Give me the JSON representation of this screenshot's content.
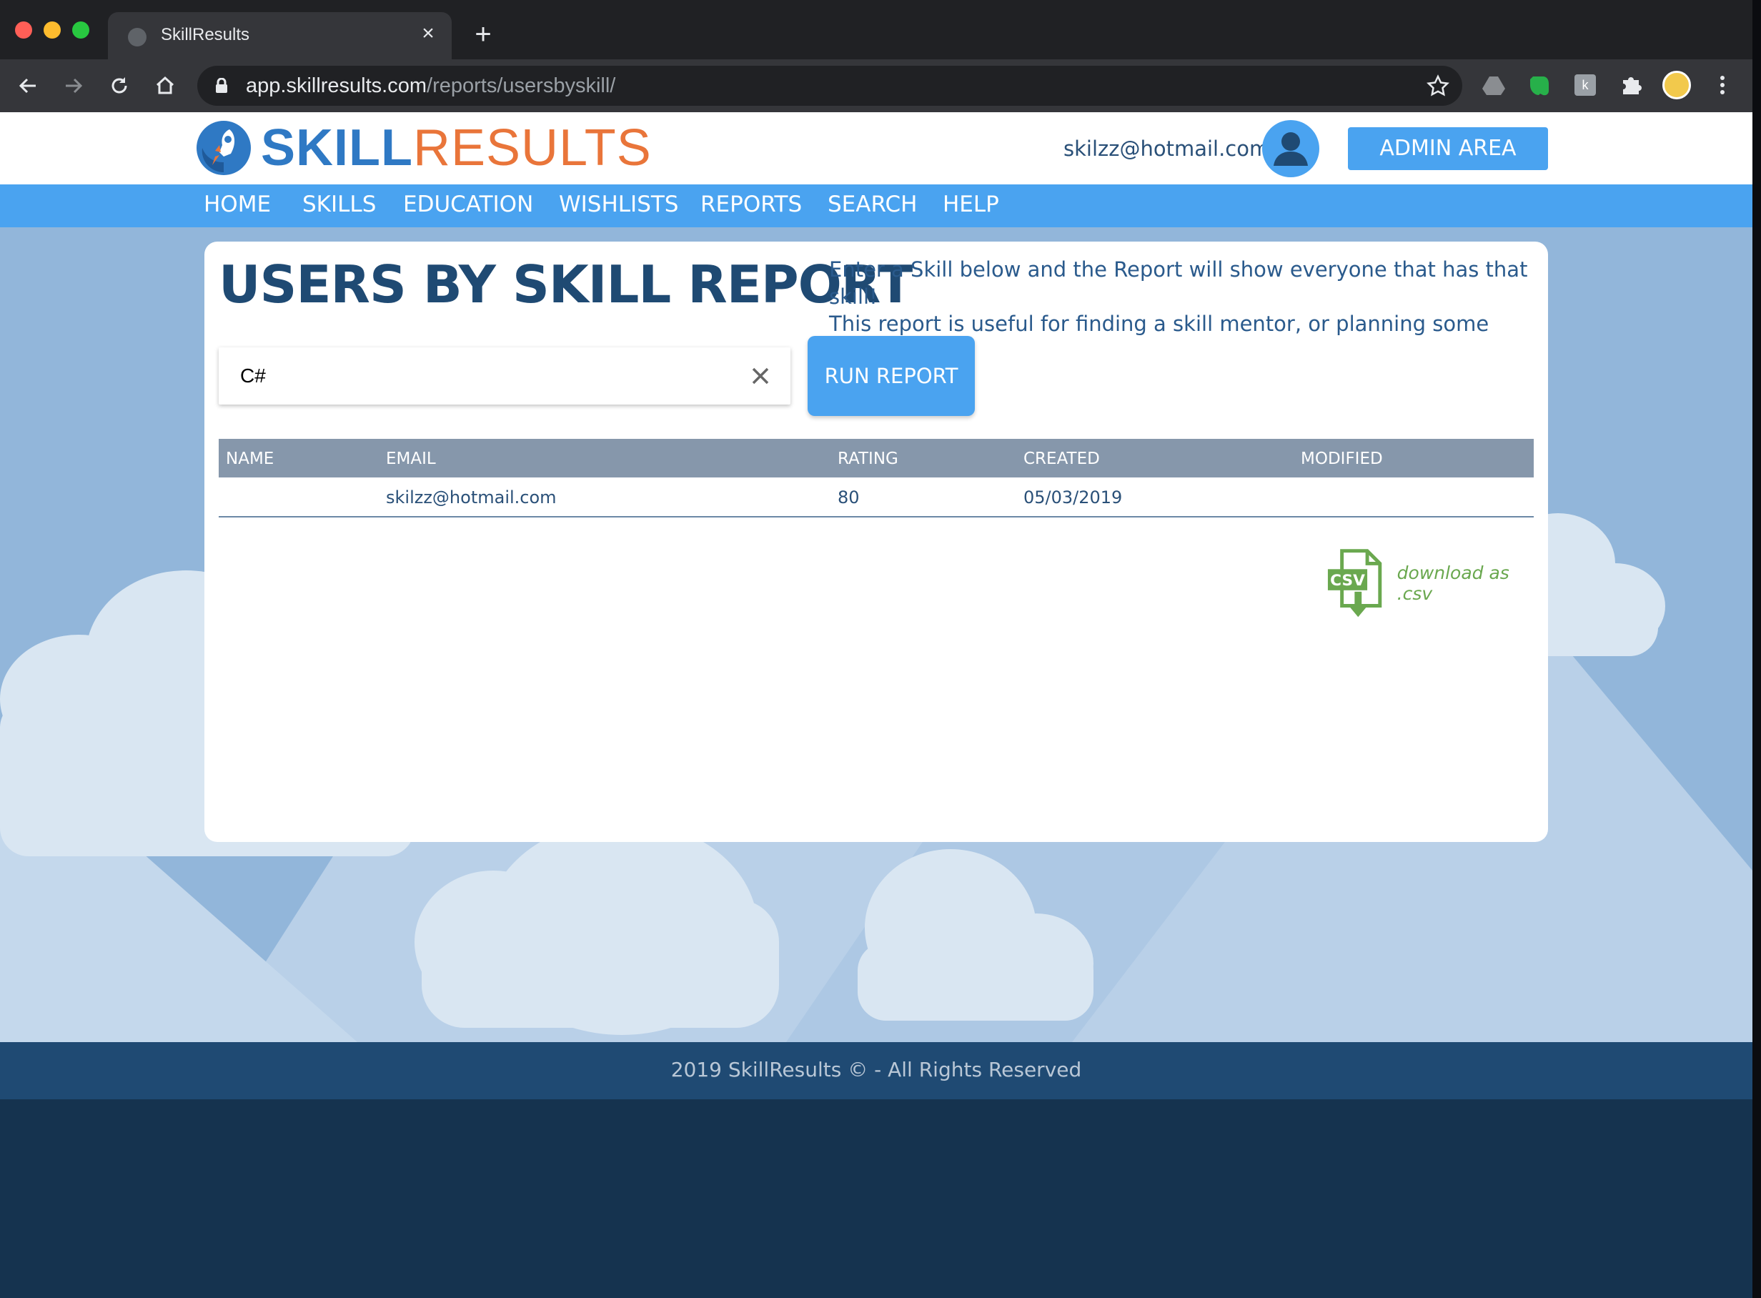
{
  "browser": {
    "tab_title": "SkillResults",
    "url_host": "app.skillresults.com",
    "url_path": "/reports/usersbyskill/"
  },
  "header": {
    "logo_skill": "SKILL",
    "logo_results": "RESULTS",
    "user_email": "skilzz@hotmail.com",
    "admin_button": "ADMIN AREA"
  },
  "nav": {
    "items": [
      "HOME",
      "SKILLS",
      "EDUCATION",
      "WISHLISTS",
      "REPORTS",
      "SEARCH",
      "HELP"
    ]
  },
  "page": {
    "title": "USERS BY SKILL REPORT",
    "description_line1": "Enter a Skill below and the Report will show everyone that has that skill!",
    "description_line2": "This report is useful for finding a skill mentor, or planning some work",
    "search_value": "C#",
    "run_button": "RUN REPORT"
  },
  "table": {
    "columns": [
      "NAME",
      "EMAIL",
      "RATING",
      "CREATED",
      "MODIFIED"
    ],
    "rows": [
      {
        "name": "",
        "email": "skilzz@hotmail.com",
        "rating": "80",
        "created": "05/03/2019",
        "modified": ""
      }
    ]
  },
  "download": {
    "icon_text": "CSV",
    "label": "download as .csv"
  },
  "footer": {
    "text": "2019 SkillResults © - All Rights Reserved"
  },
  "colors": {
    "brand_blue": "#4aa3f0",
    "navy": "#1f4a73",
    "orange": "#e9753a",
    "csv_green": "#6aa84f"
  }
}
